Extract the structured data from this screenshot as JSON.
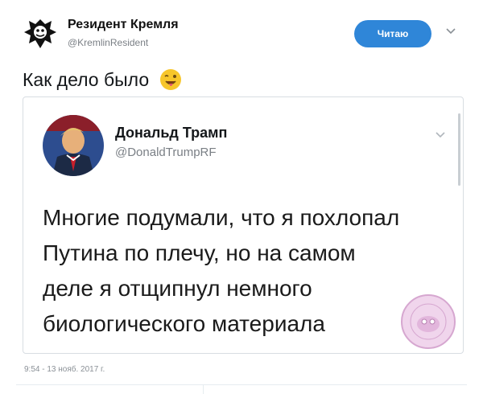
{
  "tweet": {
    "author_name": "Резидент Кремля",
    "author_handle": "@KremlinResident",
    "follow_label": "Читаю",
    "text": "Как дело было",
    "emoji_name": "winking-face-tongue-emoji",
    "timestamp": "9:54 - 13 нояб. 2017 г."
  },
  "quoted": {
    "author_name": "Дональд Трамп",
    "author_handle": "@DonaldTrumpRF",
    "lines": [
      "Многие подумали, что я похлопал",
      "Путина по плечу, но на самом",
      "деле я отщипнул немного",
      "биологического материала"
    ]
  },
  "colors": {
    "accent": "#2f86d8",
    "secondary_text": "#7a7f85",
    "border": "#d8dde2"
  },
  "icons": {
    "follow_menu": "chevron-down-icon",
    "quote_menu": "chevron-down-icon",
    "watermark": "watermark-stamp-icon"
  }
}
